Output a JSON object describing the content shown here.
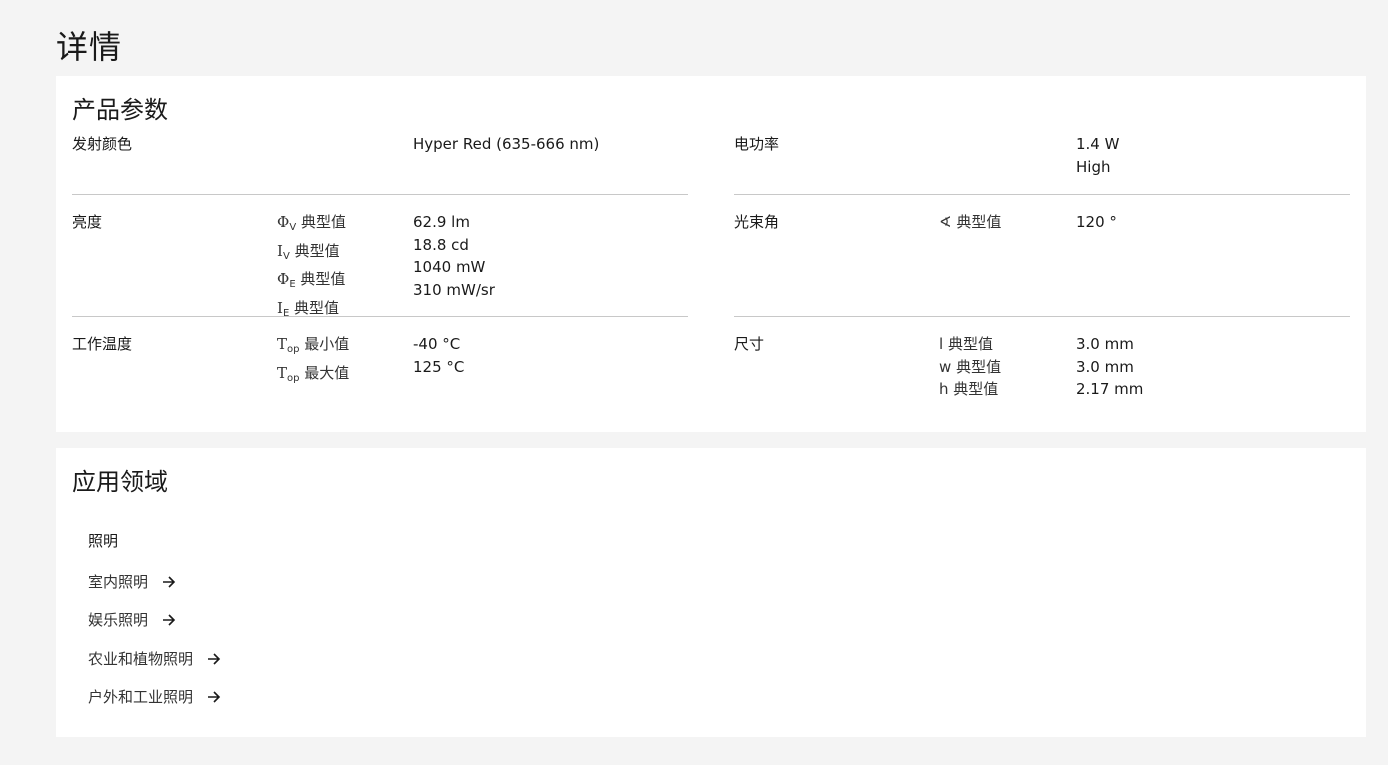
{
  "page": {
    "title": "详情"
  },
  "params": {
    "title": "产品参数",
    "left": [
      {
        "name": "发射颜色",
        "subs": [
          ""
        ],
        "values": [
          "Hyper Red (635-666 nm)"
        ]
      },
      {
        "name": "亮度",
        "subs": [
          {
            "sym": "Φ",
            "sub": "V",
            "label": "典型值"
          },
          {
            "sym": "I",
            "sub": "V",
            "label": "典型值"
          },
          {
            "sym": "Φ",
            "sub": "E",
            "label": "典型值"
          },
          {
            "sym": "I",
            "sub": "E",
            "label": "典型值"
          }
        ],
        "values": [
          "62.9 lm",
          "18.8 cd",
          "1040 mW",
          "310 mW/sr"
        ]
      },
      {
        "name": "工作温度",
        "subs": [
          {
            "sym": "T",
            "sub": "op",
            "label": "最小值"
          },
          {
            "sym": "T",
            "sub": "op",
            "label": "最大值"
          }
        ],
        "values": [
          "-40 °C",
          "125 °C"
        ]
      }
    ],
    "right": [
      {
        "name": "电功率",
        "values": [
          "1.4 W",
          "High"
        ]
      },
      {
        "name": "光束角",
        "subs": [
          {
            "sym": "∢",
            "label": "典型值"
          }
        ],
        "values": [
          "120 °"
        ]
      },
      {
        "name": "尺寸",
        "subs": [
          {
            "sym": "l",
            "label": "典型值"
          },
          {
            "sym": "w",
            "label": "典型值"
          },
          {
            "sym": "h",
            "label": "典型值"
          }
        ],
        "values": [
          "3.0 mm",
          "3.0 mm",
          "2.17 mm"
        ]
      }
    ]
  },
  "applications": {
    "title": "应用领域",
    "group": "照明",
    "links": [
      "室内照明",
      "娱乐照明",
      "农业和植物照明",
      "户外和工业照明"
    ],
    "link_icon": "arrow-right-icon"
  }
}
